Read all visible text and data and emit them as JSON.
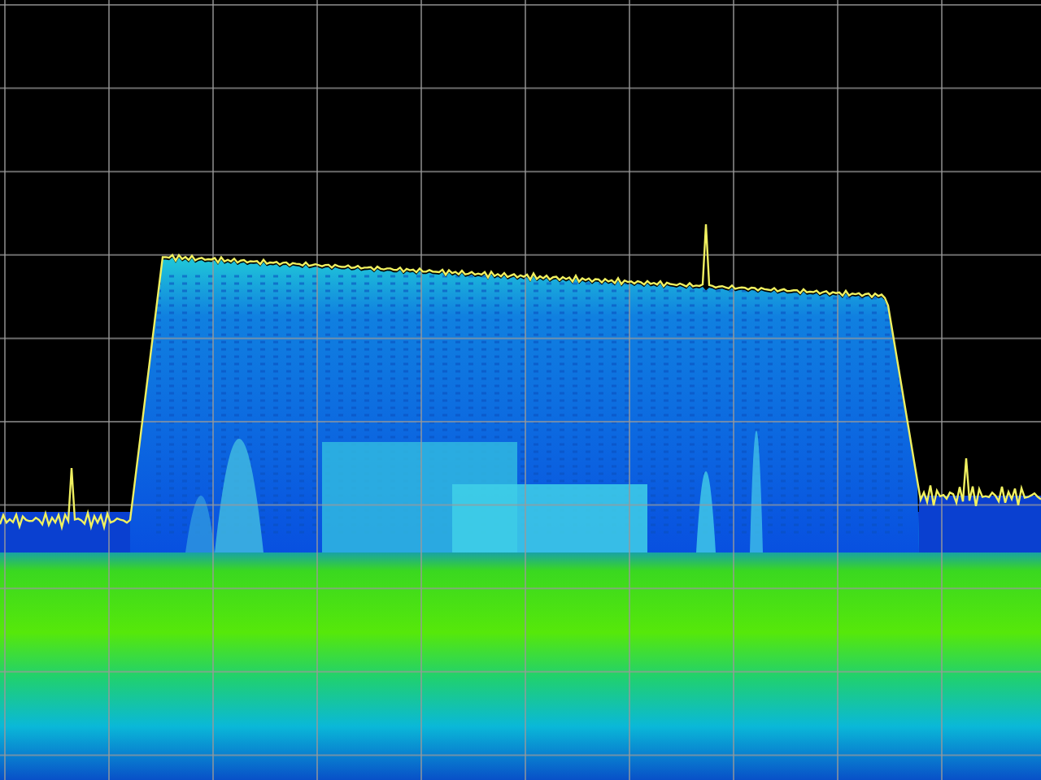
{
  "spectrum_display": {
    "grid": true,
    "peak_trace": true
  }
}
